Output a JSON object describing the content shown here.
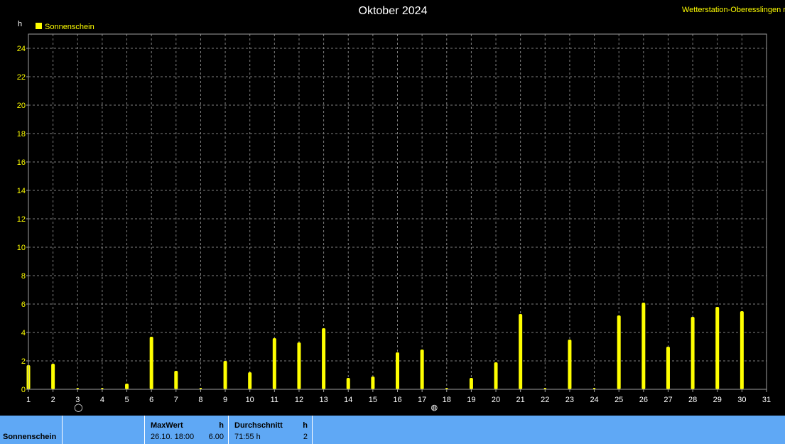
{
  "header": {
    "title": "Oktober 2024",
    "station": "Wetterstation-Oberesslingen m",
    "unit": "h"
  },
  "legend": {
    "label": "Sonnenschein",
    "color": "#ffff00"
  },
  "moon_phases": [
    {
      "day": 3,
      "icon": "new-moon-icon",
      "glyph": "◯"
    },
    {
      "day": 17.5,
      "icon": "full-moon-icon",
      "glyph": "◍"
    }
  ],
  "chart_data": {
    "type": "bar",
    "x": [
      1,
      2,
      3,
      4,
      5,
      6,
      7,
      8,
      9,
      10,
      11,
      12,
      13,
      14,
      15,
      16,
      17,
      18,
      19,
      20,
      21,
      22,
      23,
      24,
      25,
      26,
      27,
      28,
      29,
      30
    ],
    "xticks": [
      "1",
      "2",
      "3",
      "4",
      "5",
      "6",
      "7",
      "8",
      "9",
      "10",
      "11",
      "12",
      "13",
      "14",
      "15",
      "16",
      "17",
      "18",
      "19",
      "20",
      "21",
      "22",
      "23",
      "24",
      "25",
      "26",
      "27",
      "28",
      "29",
      "30",
      "31"
    ],
    "yticks": [
      "0",
      "2",
      "4",
      "6",
      "8",
      "10",
      "12",
      "14",
      "16",
      "18",
      "20",
      "22",
      "24"
    ],
    "series": [
      {
        "name": "Sonnenschein",
        "color": "#ffff00",
        "values": [
          1.7,
          1.8,
          0,
          0,
          0.4,
          3.7,
          1.3,
          0,
          2.0,
          1.2,
          3.6,
          3.3,
          4.3,
          0.8,
          0.9,
          2.6,
          2.8,
          0,
          0.8,
          1.9,
          5.3,
          0,
          3.5,
          0,
          5.2,
          6.1,
          3.0,
          5.1,
          5.8,
          5.5
        ]
      }
    ],
    "xlim": [
      1,
      31
    ],
    "ylim": [
      0,
      25
    ],
    "grid": true,
    "legend_position": "top-left"
  },
  "stats": {
    "row_label": "Sonnenschein",
    "max_header": "MaxWert",
    "max_unit": "h",
    "max_date": "26.10.  18:00",
    "max_value": "6.00",
    "avg_header": "Durchschnitt",
    "avg_unit": "h",
    "avg_value": "71:55 h",
    "avg_count": "2"
  }
}
